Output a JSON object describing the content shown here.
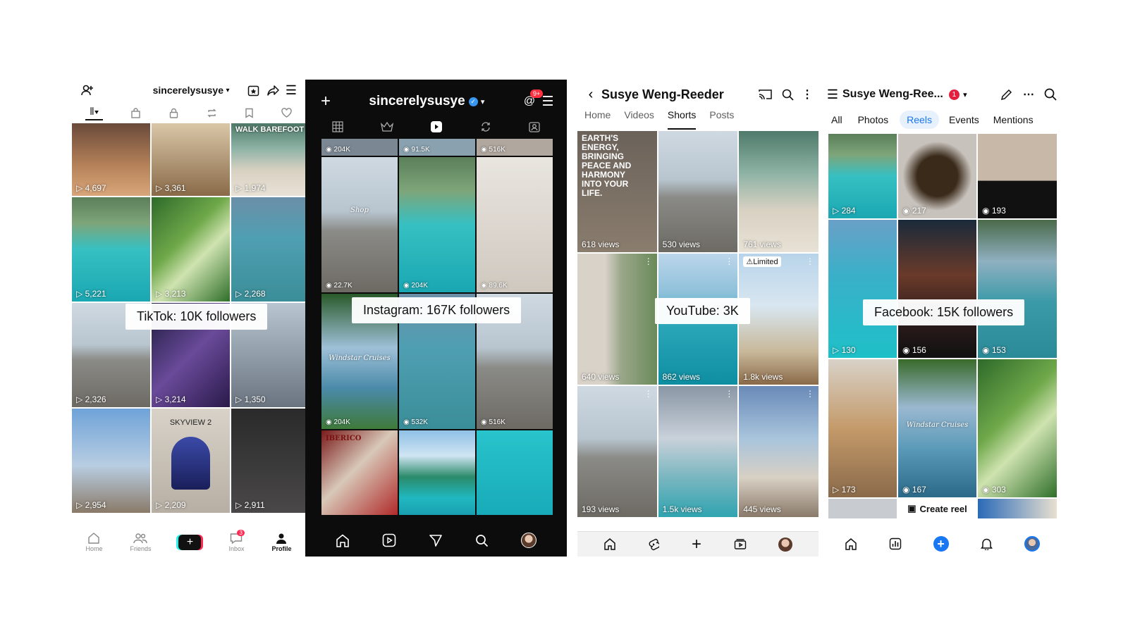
{
  "tiktok": {
    "username": "sincerelysusye",
    "tiles": [
      {
        "views": "4,697",
        "text": ""
      },
      {
        "views": "3,361",
        "text": ""
      },
      {
        "views": "1,974",
        "text": "WALK BAREFOOT"
      },
      {
        "views": "5,221",
        "text": ""
      },
      {
        "views": "3,213",
        "text": ""
      },
      {
        "views": "2,268",
        "text": ""
      },
      {
        "views": "2,326",
        "text": ""
      },
      {
        "views": "3,214",
        "text": ""
      },
      {
        "views": "1,350",
        "text": ""
      },
      {
        "views": "2,954",
        "text": ""
      },
      {
        "views": "2,209",
        "text": "SKYVIEW 2"
      },
      {
        "views": "2,911",
        "text": ""
      }
    ],
    "overlay": "TikTok: 10K followers",
    "nav": {
      "home": "Home",
      "friends": "Friends",
      "inbox": "Inbox",
      "inbox_badge": "3",
      "profile": "Profile"
    }
  },
  "instagram": {
    "username": "sincerelysusye",
    "badge": "9+",
    "top_counts": [
      "204K",
      "91.5K",
      "516K"
    ],
    "tiles": [
      {
        "views": "22.7K"
      },
      {
        "views": "204K"
      },
      {
        "views": "89.6K"
      },
      {
        "views": "204K"
      },
      {
        "views": "532K"
      },
      {
        "views": "516K"
      },
      {
        "views": ""
      },
      {
        "views": ""
      },
      {
        "views": ""
      }
    ],
    "overlay": "Instagram: 167K followers"
  },
  "youtube": {
    "channel": "Susye Weng-Reeder",
    "tabs": [
      "Home",
      "Videos",
      "Shorts",
      "Posts"
    ],
    "active_tab": "Shorts",
    "first_tile_text": "EARTH'S ENERGY, BRINGING PEACE AND HARMONY INTO YOUR LIFE.",
    "limited_label": "Limited",
    "tiles": [
      {
        "views": "618 views"
      },
      {
        "views": "530 views"
      },
      {
        "views": "761 views"
      },
      {
        "views": "640 views"
      },
      {
        "views": "862 views"
      },
      {
        "views": "1.8k views"
      },
      {
        "views": "193 views"
      },
      {
        "views": "1.5k views"
      },
      {
        "views": "445 views"
      }
    ],
    "overlay": "YouTube: 3K"
  },
  "facebook": {
    "name": "Susye Weng-Ree...",
    "badge": "1",
    "tabs": [
      "All",
      "Photos",
      "Reels",
      "Events",
      "Mentions"
    ],
    "active_tab": "Reels",
    "tiles": [
      {
        "views": "284"
      },
      {
        "views": "217"
      },
      {
        "views": "193"
      },
      {
        "views": "130"
      },
      {
        "views": "156"
      },
      {
        "views": "153"
      },
      {
        "views": "173"
      },
      {
        "views": "167"
      },
      {
        "views": "303"
      }
    ],
    "overlay": "Facebook: 15K followers",
    "create_reel": "Create reel",
    "accent": "#1877f2"
  }
}
